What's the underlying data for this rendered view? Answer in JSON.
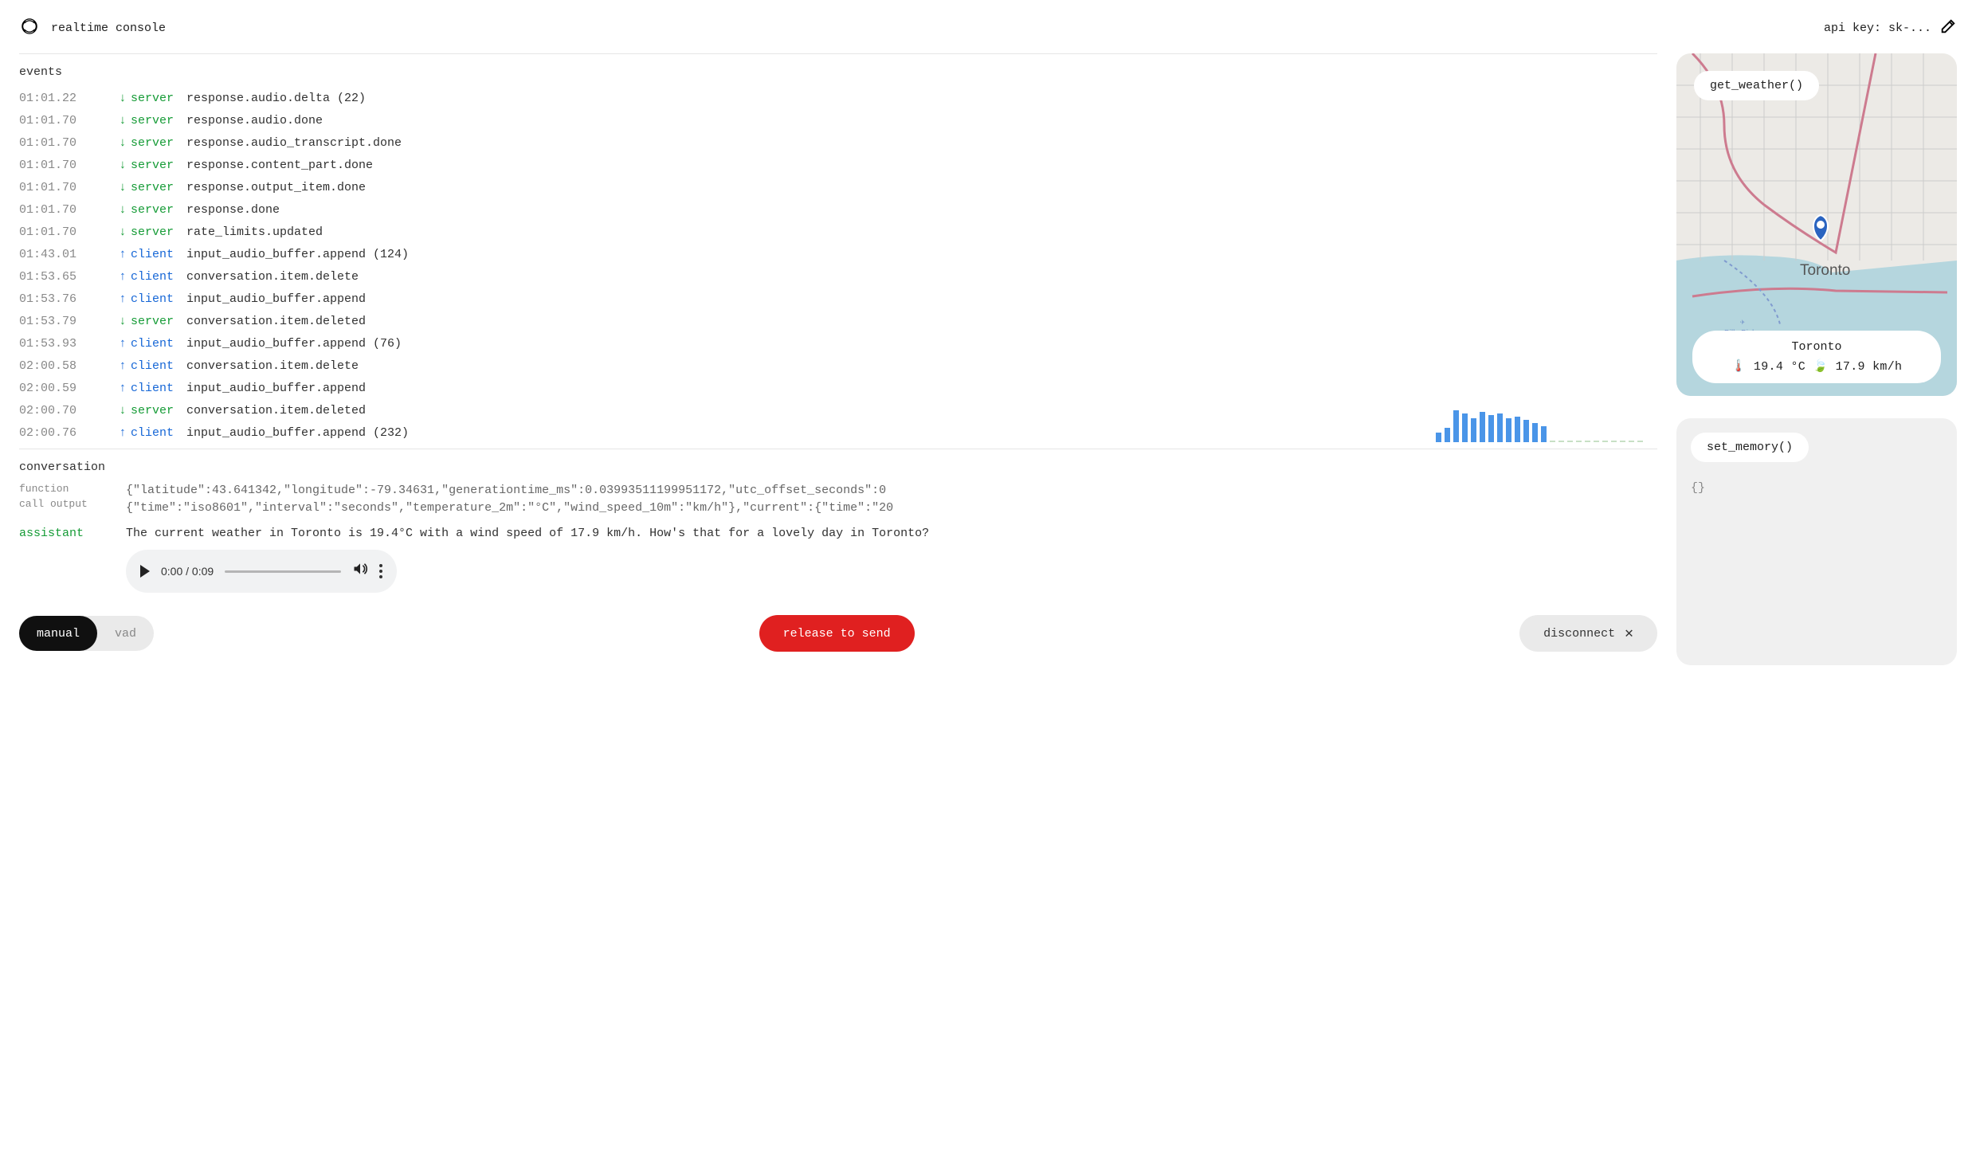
{
  "header": {
    "title": "realtime console",
    "api_key_label": "api key: sk-..."
  },
  "events_title": "events",
  "events": [
    {
      "ts": "01:01.22",
      "dir": "server",
      "name": "response.audio.delta (22)"
    },
    {
      "ts": "01:01.70",
      "dir": "server",
      "name": "response.audio.done"
    },
    {
      "ts": "01:01.70",
      "dir": "server",
      "name": "response.audio_transcript.done"
    },
    {
      "ts": "01:01.70",
      "dir": "server",
      "name": "response.content_part.done"
    },
    {
      "ts": "01:01.70",
      "dir": "server",
      "name": "response.output_item.done"
    },
    {
      "ts": "01:01.70",
      "dir": "server",
      "name": "response.done"
    },
    {
      "ts": "01:01.70",
      "dir": "server",
      "name": "rate_limits.updated"
    },
    {
      "ts": "01:43.01",
      "dir": "client",
      "name": "input_audio_buffer.append (124)"
    },
    {
      "ts": "01:53.65",
      "dir": "client",
      "name": "conversation.item.delete"
    },
    {
      "ts": "01:53.76",
      "dir": "client",
      "name": "input_audio_buffer.append"
    },
    {
      "ts": "01:53.79",
      "dir": "server",
      "name": "conversation.item.deleted"
    },
    {
      "ts": "01:53.93",
      "dir": "client",
      "name": "input_audio_buffer.append (76)"
    },
    {
      "ts": "02:00.58",
      "dir": "client",
      "name": "conversation.item.delete"
    },
    {
      "ts": "02:00.59",
      "dir": "client",
      "name": "input_audio_buffer.append"
    },
    {
      "ts": "02:00.70",
      "dir": "server",
      "name": "conversation.item.deleted"
    },
    {
      "ts": "02:00.76",
      "dir": "client",
      "name": "input_audio_buffer.append (232)"
    }
  ],
  "waveform_bars": [
    12,
    18,
    40,
    36,
    30,
    38,
    34,
    36,
    30,
    32,
    28,
    24,
    20,
    2,
    2,
    2,
    2,
    2,
    2,
    2,
    2,
    2,
    2,
    2
  ],
  "conversation_title": "conversation",
  "conversation": {
    "func_label": "function\ncall output",
    "json_line1": "{\"latitude\":43.641342,\"longitude\":-79.34631,\"generationtime_ms\":0.03993511199951172,\"utc_offset_seconds\":0",
    "json_line2": "{\"time\":\"iso8601\",\"interval\":\"seconds\",\"temperature_2m\":\"°C\",\"wind_speed_10m\":\"km/h\"},\"current\":{\"time\":\"20",
    "assistant_label": "assistant",
    "assistant_text": "The current weather in Toronto is 19.4°C with a wind speed of 17.9 km/h. How's that for a lovely day in Toronto?"
  },
  "player": {
    "time": "0:00 / 0:09"
  },
  "footer": {
    "manual_label": "manual",
    "vad_label": "vad",
    "release_label": "release to send",
    "disconnect_label": "disconnect"
  },
  "map_panel": {
    "fn_label": "get_weather()",
    "city": "Toronto",
    "city_map_label": "Toronto",
    "temp_label": "🌡️ 19.4 °C 🍃 17.9 km/h",
    "airport_label": "Billy Bishop\nToronto\nCity Airport"
  },
  "memory_panel": {
    "fn_label": "set_memory()",
    "body": "{}"
  }
}
